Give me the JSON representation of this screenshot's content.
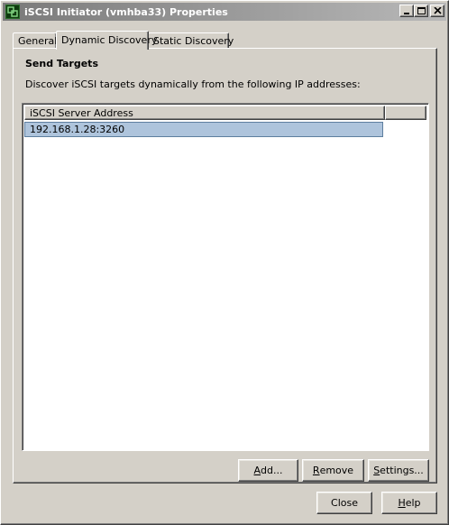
{
  "window": {
    "title": "iSCSI Initiator (vmhba33) Properties",
    "icon": "vsphere-app-icon"
  },
  "tabs": [
    {
      "label": "General",
      "active": false
    },
    {
      "label": "Dynamic Discovery",
      "active": true
    },
    {
      "label": "Static Discovery",
      "active": false
    }
  ],
  "panel": {
    "section_title": "Send Targets",
    "description": "Discover iSCSI targets dynamically from the following IP addresses:",
    "list": {
      "columns": [
        "iSCSI Server Address"
      ],
      "rows": [
        "192.168.1.28:3260"
      ],
      "selected_row": 0
    },
    "buttons": {
      "add_accel": "A",
      "add_rest": "dd...",
      "remove_accel": "R",
      "remove_rest": "emove",
      "settings_accel": "S",
      "settings_rest": "ettings..."
    }
  },
  "footer": {
    "close_label": "Close",
    "help_accel": "H",
    "help_rest": "elp"
  },
  "colors": {
    "face": "#d4d0c8",
    "selection": "#aec4dc",
    "titlebar_start": "#7a7a7a",
    "titlebar_end": "#b8b8b8"
  }
}
